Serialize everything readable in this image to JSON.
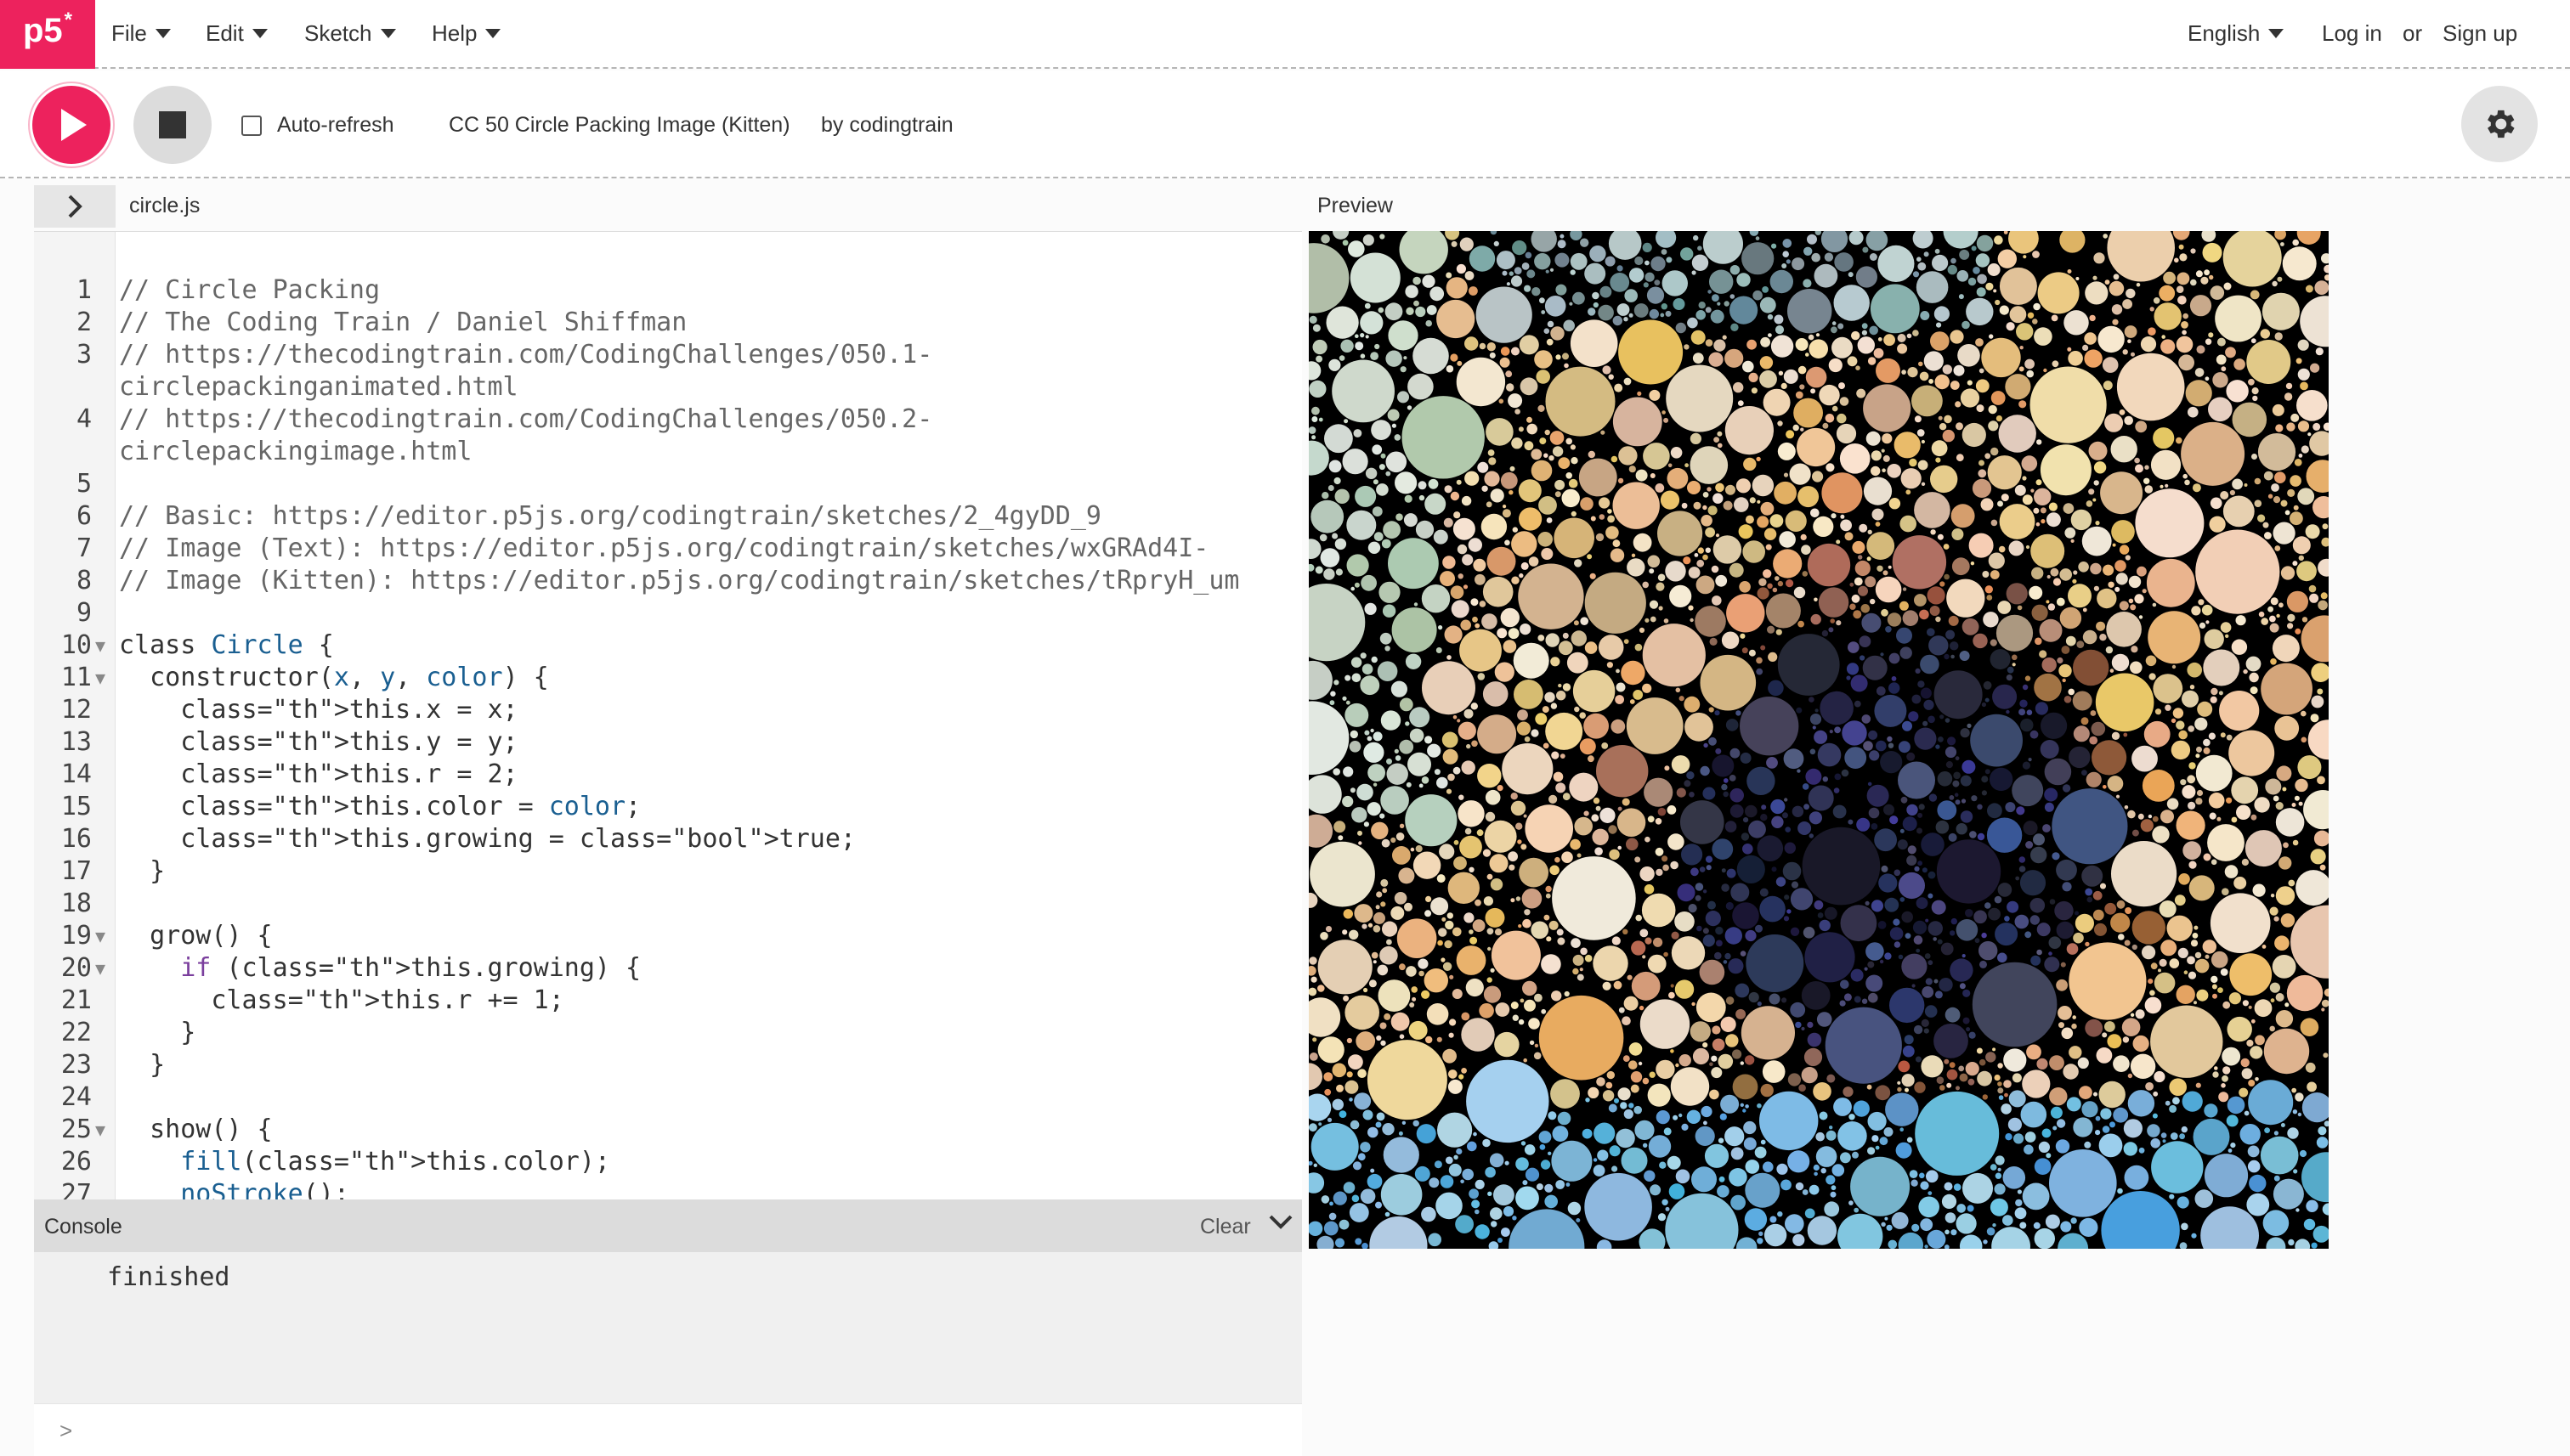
{
  "nav": {
    "logo_text": "p5",
    "logo_sup": "*",
    "menus": [
      "File",
      "Edit",
      "Sketch",
      "Help"
    ],
    "language": "English",
    "login": "Log in",
    "or": "or",
    "signup": "Sign up"
  },
  "toolbar": {
    "auto_refresh_label": "Auto-refresh",
    "auto_refresh_checked": false,
    "sketch_name": "CC 50 Circle Packing Image (Kitten)",
    "by_label": "by",
    "author": "codingtrain"
  },
  "editor": {
    "file_name": "circle.js",
    "lines": [
      {
        "n": "1",
        "text": "// Circle Packing"
      },
      {
        "n": "2",
        "text": "// The Coding Train / Daniel Shiffman"
      },
      {
        "n": "3",
        "text": "// https://thecodingtrain.com/CodingChallenges/050.1-"
      },
      {
        "n": "",
        "text": "circlepackinganimated.html"
      },
      {
        "n": "4",
        "text": "// https://thecodingtrain.com/CodingChallenges/050.2-"
      },
      {
        "n": "",
        "text": "circlepackingimage.html"
      },
      {
        "n": "5",
        "text": ""
      },
      {
        "n": "6",
        "text": "// Basic: https://editor.p5js.org/codingtrain/sketches/2_4gyDD_9"
      },
      {
        "n": "7",
        "text": "// Image (Text): https://editor.p5js.org/codingtrain/sketches/wxGRAd4I-"
      },
      {
        "n": "8",
        "text": "// Image (Kitten): https://editor.p5js.org/codingtrain/sketches/tRpryH_um"
      },
      {
        "n": "9",
        "text": ""
      },
      {
        "n": "10",
        "text": "class Circle {",
        "fold": true
      },
      {
        "n": "11",
        "text": "  constructor(x, y, color) {",
        "fold": true
      },
      {
        "n": "12",
        "text": "    this.x = x;"
      },
      {
        "n": "13",
        "text": "    this.y = y;"
      },
      {
        "n": "14",
        "text": "    this.r = 2;"
      },
      {
        "n": "15",
        "text": "    this.color = color;"
      },
      {
        "n": "16",
        "text": "    this.growing = true;"
      },
      {
        "n": "17",
        "text": "  }"
      },
      {
        "n": "18",
        "text": ""
      },
      {
        "n": "19",
        "text": "  grow() {",
        "fold": true
      },
      {
        "n": "20",
        "text": "    if (this.growing) {",
        "fold": true
      },
      {
        "n": "21",
        "text": "      this.r += 1;"
      },
      {
        "n": "22",
        "text": "    }"
      },
      {
        "n": "23",
        "text": "  }"
      },
      {
        "n": "24",
        "text": ""
      },
      {
        "n": "25",
        "text": "  show() {",
        "fold": true
      },
      {
        "n": "26",
        "text": "    fill(this.color);"
      },
      {
        "n": "27",
        "text": "    noStroke();"
      }
    ]
  },
  "console": {
    "label": "Console",
    "clear_label": "Clear",
    "message": "finished",
    "prompt": ">"
  },
  "preview": {
    "label": "Preview"
  },
  "colors": {
    "brand": "#ed225d",
    "stop_button": "#dcdcdc",
    "settings_button": "#e3e3e3",
    "console_header": "#dcdcdc"
  },
  "icons": {
    "play": "play-icon",
    "stop": "stop-icon",
    "settings": "gear-icon",
    "sidebar_toggle": "chevron-right-icon",
    "console_collapse": "chevron-down-icon"
  }
}
